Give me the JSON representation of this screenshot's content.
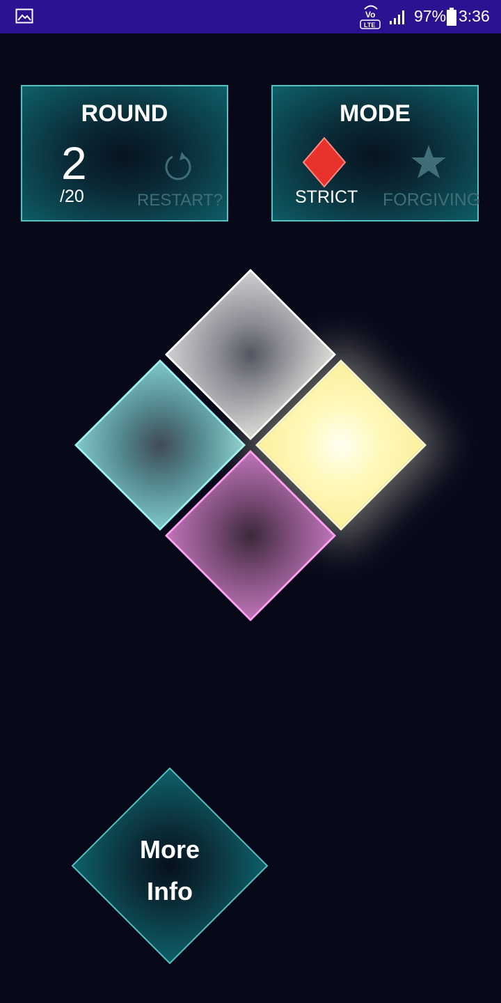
{
  "status_bar": {
    "battery_percent": "97%",
    "time": "3:36",
    "network_label": "Vo LTE",
    "icons": [
      "gallery-icon",
      "volte-icon",
      "signal-icon",
      "battery-icon"
    ]
  },
  "round_panel": {
    "title": "ROUND",
    "current": "2",
    "total": "/20",
    "restart_label": "RESTART?",
    "icon": "restart-icon"
  },
  "mode_panel": {
    "title": "MODE",
    "strict_label": "STRICT",
    "forgiving_label": "FORGIVING",
    "selected": "strict",
    "icons": [
      "diamond-icon",
      "star-icon"
    ]
  },
  "board": {
    "tiles": [
      {
        "name": "white",
        "color": "#cfcfd1",
        "lit": false
      },
      {
        "name": "cyan",
        "color": "#7fc7c8",
        "lit": false
      },
      {
        "name": "yellow",
        "color": "#fff9bd",
        "lit": true
      },
      {
        "name": "pink",
        "color": "#bd74b7",
        "lit": false
      }
    ]
  },
  "more_info": {
    "line1": "More",
    "line2": "Info"
  },
  "colors": {
    "status_bar": "#2a1290",
    "background": "#070818",
    "panel_border": "#58c3c6",
    "inactive_text": "#3f6e76",
    "strict_diamond": "#e8322c"
  }
}
